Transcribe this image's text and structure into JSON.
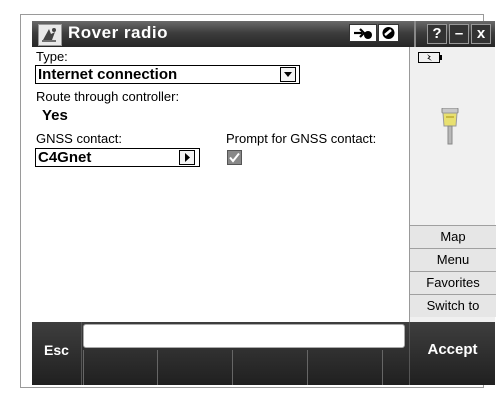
{
  "window": {
    "title": "Rover radio",
    "icons": [
      "app-icon",
      "connect-icon",
      "status-circle-icon",
      "help-icon",
      "minimize-icon",
      "close-icon"
    ],
    "help_label": "?",
    "minimize_label": "–",
    "close_label": "x"
  },
  "form": {
    "type_label": "Type:",
    "type_value": "Internet connection",
    "route_label": "Route through controller:",
    "route_value": "Yes",
    "gnss_label": "GNSS contact:",
    "gnss_value": "C4Gnet",
    "prompt_label": "Prompt for GNSS contact:",
    "prompt_checked": true
  },
  "side_panel": {
    "items": [
      {
        "label": "Map"
      },
      {
        "label": "Menu"
      },
      {
        "label": "Favorites"
      },
      {
        "label": "Switch to"
      }
    ]
  },
  "bottom": {
    "esc_label": "Esc",
    "accept_label": "Accept",
    "message": ""
  },
  "colors": {
    "title_bar": "#2b2b2b",
    "bottom_bar": "#2a2a2a",
    "panel": "#f0f0f0"
  }
}
